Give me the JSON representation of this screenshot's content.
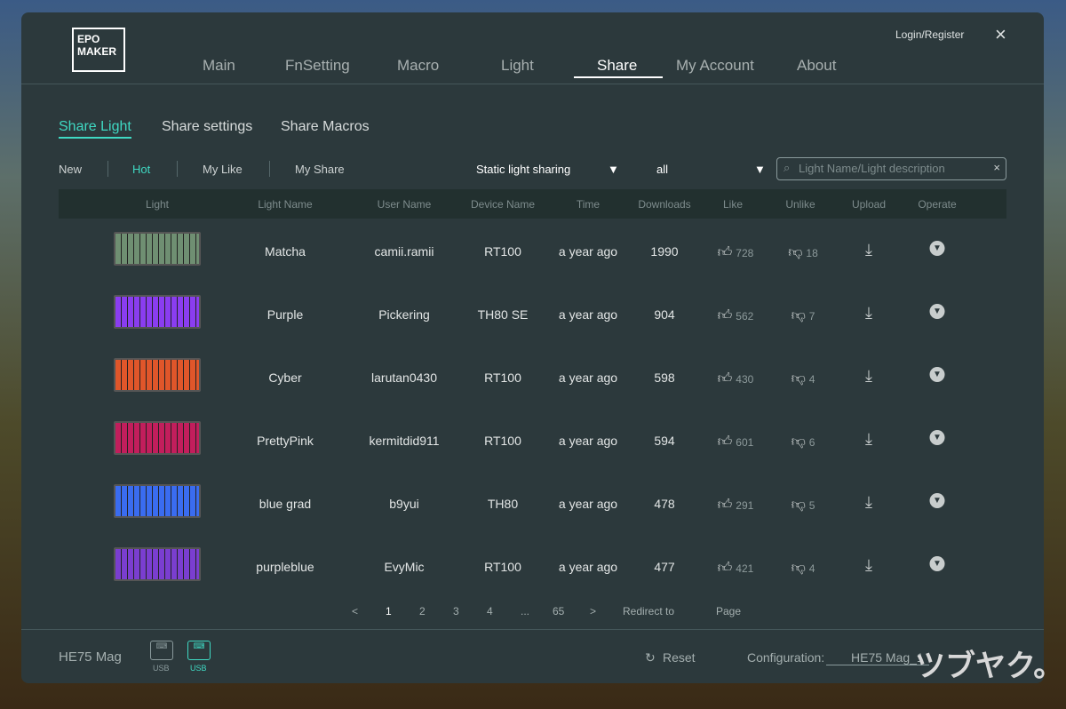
{
  "header": {
    "logo_text": "EPOMAKER",
    "login": "Login/Register",
    "close": "×",
    "nav": [
      "Main",
      "FnSetting",
      "Macro",
      "Light",
      "Share",
      "My Account",
      "About"
    ],
    "active_nav": "Share"
  },
  "subtabs": [
    "Share Light",
    "Share settings",
    "Share Macros"
  ],
  "filters": [
    "New",
    "Hot",
    "My Like",
    "My Share"
  ],
  "active_filter": "Hot",
  "type_select": "Static light sharing",
  "device_select": "all",
  "dropdown_arrow": "▼",
  "search": {
    "placeholder": "Light Name/Light description",
    "clear": "×"
  },
  "columns": [
    "Light",
    "Light Name",
    "User Name",
    "Device Name",
    "Time",
    "Downloads",
    "Like",
    "Unlike",
    "Upload",
    "Operate"
  ],
  "rows": [
    {
      "name": "Matcha",
      "user": "camii.ramii",
      "device": "RT100",
      "time": "a year ago",
      "downloads": "1990",
      "like": "728",
      "unlike": "18",
      "color": "#6f8f72"
    },
    {
      "name": "Purple",
      "user": "Pickering",
      "device": "TH80 SE",
      "time": "a year ago",
      "downloads": "904",
      "like": "562",
      "unlike": "7",
      "color": "#8a3df0"
    },
    {
      "name": "Cyber",
      "user": "larutan0430",
      "device": "RT100",
      "time": "a year ago",
      "downloads": "598",
      "like": "430",
      "unlike": "4",
      "color": "#e0562a"
    },
    {
      "name": "PrettyPink",
      "user": "kermitdid911",
      "device": "RT100",
      "time": "a year ago",
      "downloads": "594",
      "like": "601",
      "unlike": "6",
      "color": "#c21e5c"
    },
    {
      "name": "blue grad",
      "user": "b9yui",
      "device": "TH80",
      "time": "a year ago",
      "downloads": "478",
      "like": "291",
      "unlike": "5",
      "color": "#3a6cf0"
    },
    {
      "name": "purpleblue",
      "user": "EvyMic",
      "device": "RT100",
      "time": "a year ago",
      "downloads": "477",
      "like": "421",
      "unlike": "4",
      "color": "#7a3ed0"
    }
  ],
  "pagination": {
    "prev": "<",
    "pages": [
      "1",
      "2",
      "3",
      "4",
      "...",
      "65"
    ],
    "current": "1",
    "next": ">",
    "redirect": "Redirect to",
    "page": "Page"
  },
  "footer": {
    "device": "HE75 Mag",
    "usb1": "USB",
    "usb2": "USB",
    "reset": "Reset",
    "config_label": "Configuration:",
    "config_value": "HE75 Mag_1"
  },
  "watermark": "ツブヤク。",
  "colors": {
    "accent": "#3fd9c3",
    "panel": "#2c393c"
  }
}
